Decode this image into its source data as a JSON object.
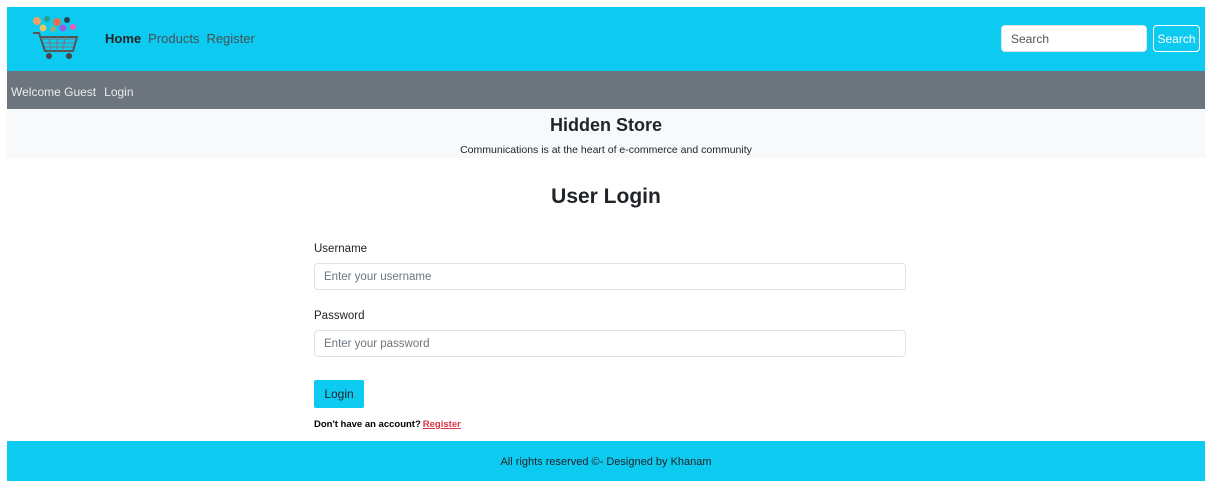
{
  "navbar": {
    "logo_icon": "shopping-cart-logo-icon",
    "links": [
      {
        "label": "Home",
        "active": true
      },
      {
        "label": "Products",
        "active": false
      },
      {
        "label": "Register",
        "active": false
      }
    ],
    "search": {
      "placeholder": "Search",
      "button_label": "Search"
    }
  },
  "subbar": {
    "welcome": "Welcome Guest",
    "login_label": "Login"
  },
  "store": {
    "title": "Hidden Store",
    "tagline": "Communications is at the heart of e-commerce and community"
  },
  "login": {
    "title": "User Login",
    "username_label": "Username",
    "username_placeholder": "Enter your username",
    "password_label": "Password",
    "password_placeholder": "Enter your password",
    "submit_label": "Login",
    "no_account_text": "Don't have an account?",
    "register_label": "Register"
  },
  "footer": {
    "text": "All rights reserved ©- Designed by Khanam"
  },
  "colors": {
    "accent": "#0dcaf0",
    "subbar": "#6c757d",
    "header_bg": "#f8f9fa",
    "link_red": "#dc3545"
  }
}
